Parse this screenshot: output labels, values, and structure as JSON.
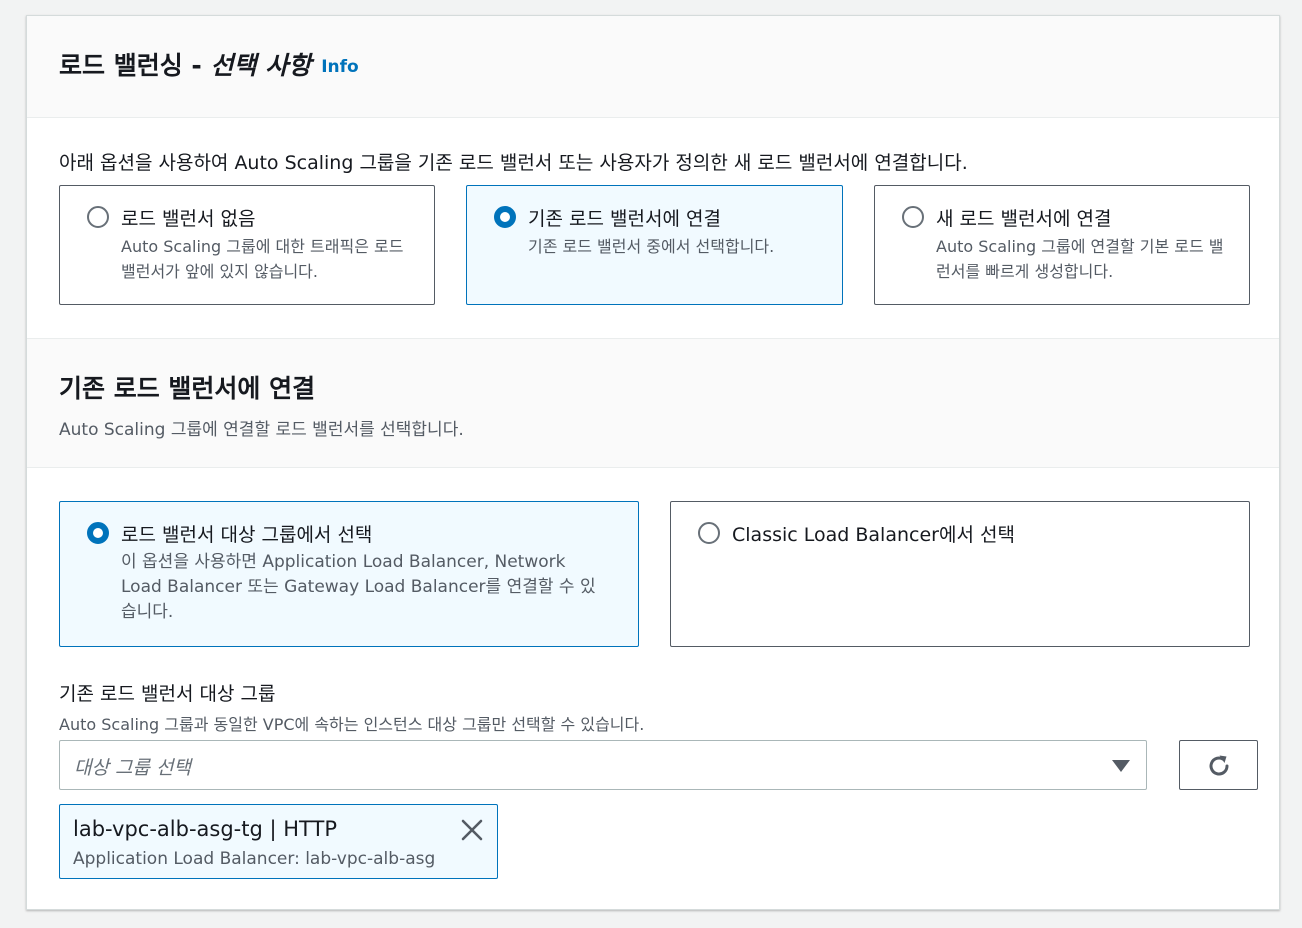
{
  "panel": {
    "title_main": "로드 밸런싱 - ",
    "title_optional": "선택 사항",
    "info_label": "Info",
    "intro": "아래 옵션을 사용하여 Auto Scaling 그룹을 기존 로드 밸런서 또는 사용자가 정의한 새 로드 밸런서에 연결합니다."
  },
  "lb_options": [
    {
      "title": "로드 밸런서 없음",
      "desc": "Auto Scaling 그룹에 대한 트래픽은 로드 밸런서가 앞에 있지 않습니다.",
      "selected": false
    },
    {
      "title": "기존 로드 밸런서에 연결",
      "desc": "기존 로드 밸런서 중에서 선택합니다.",
      "selected": true
    },
    {
      "title": "새 로드 밸런서에 연결",
      "desc": "Auto Scaling 그룹에 연결할 기본 로드 밸런서를 빠르게 생성합니다.",
      "selected": false
    }
  ],
  "existing": {
    "title": "기존 로드 밸런서에 연결",
    "desc": "Auto Scaling 그룹에 연결할 로드 밸런서를 선택합니다.",
    "options": [
      {
        "title": "로드 밸런서 대상 그룹에서 선택",
        "desc": "이 옵션을 사용하면 Application Load Balancer, Network Load Balancer 또는 Gateway Load Balancer를 연결할 수 있습니다.",
        "selected": true
      },
      {
        "title": "Classic Load Balancer에서 선택",
        "desc": "",
        "selected": false
      }
    ]
  },
  "target_group": {
    "label": "기존 로드 밸런서 대상 그룹",
    "desc": "Auto Scaling 그룹과 동일한 VPC에 속하는 인스턴스 대상 그룹만 선택할 수 있습니다.",
    "placeholder": "대상 그룹 선택",
    "selected_token": {
      "title": "lab-vpc-alb-asg-tg | HTTP",
      "desc": "Application Load Balancer: lab-vpc-alb-asg"
    }
  },
  "colors": {
    "accent": "#0073bb",
    "selected_bg": "#f1faff",
    "border": "#545b64"
  },
  "icons": {
    "refresh": "refresh-icon",
    "remove": "close-icon",
    "dropdown": "caret-down-icon"
  }
}
